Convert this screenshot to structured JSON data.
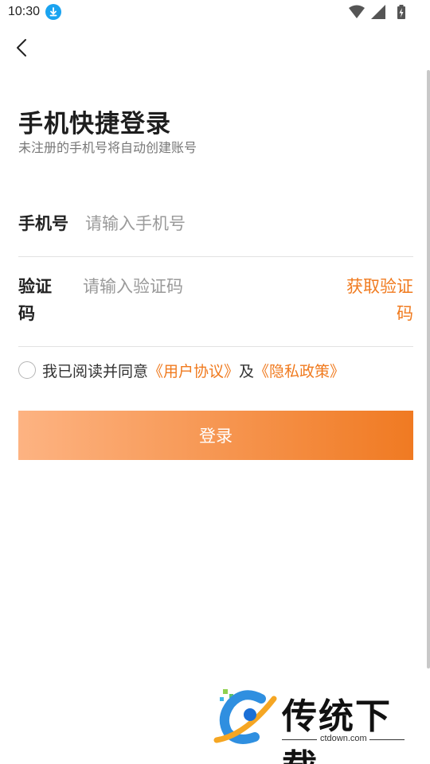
{
  "status_bar": {
    "time": "10:30",
    "icons": [
      "download-icon",
      "wifi-icon",
      "signal-icon",
      "battery-icon"
    ]
  },
  "nav": {
    "back_icon": "chevron-left-icon"
  },
  "header": {
    "title": "手机快捷登录",
    "subtitle": "未注册的手机号将自动创建账号"
  },
  "form": {
    "phone": {
      "label": "手机号",
      "placeholder": "请输入手机号",
      "value": ""
    },
    "code": {
      "label_line1": "验证",
      "label_line2": "码",
      "placeholder": "请输入验证码",
      "value": "",
      "get_code_line1": "获取验证",
      "get_code_line2": "码"
    }
  },
  "agreement": {
    "checked": false,
    "prefix": "我已阅读并同意",
    "user_agreement": "《用户协议》",
    "conjunction": "及",
    "privacy_policy": "《隐私政策》"
  },
  "login_button": {
    "label": "登录"
  },
  "watermark": {
    "name": "传统下载",
    "url": "ctdown.com"
  },
  "colors": {
    "accent": "#f07a1e",
    "button_gradient_start": "#fdb382",
    "button_gradient_end": "#f07a22"
  }
}
